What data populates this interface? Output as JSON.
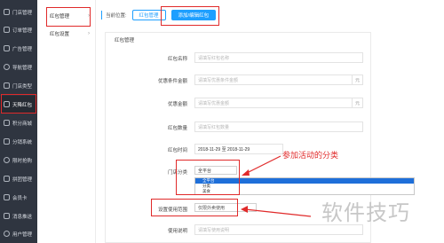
{
  "sidebar": {
    "items": [
      {
        "label": "门店管理"
      },
      {
        "label": "订单管理"
      },
      {
        "label": "广告管理"
      },
      {
        "label": "导航管理"
      },
      {
        "label": "门店类型"
      },
      {
        "label": "天降红包"
      },
      {
        "label": "积分商城"
      },
      {
        "label": "分销系统"
      },
      {
        "label": "限时抢购"
      },
      {
        "label": "拼团管理"
      },
      {
        "label": "会员卡"
      },
      {
        "label": "消息推送"
      },
      {
        "label": "用户管理"
      }
    ],
    "active_index": 5
  },
  "submenu": {
    "items": [
      {
        "label": "红包管理"
      },
      {
        "label": "红包设置"
      }
    ]
  },
  "topbar": {
    "crumb_label": "当前位置:",
    "tabs": [
      {
        "label": "红包管理"
      },
      {
        "label": "添加/编辑红包"
      }
    ]
  },
  "panel": {
    "title": "红包管理",
    "fields": [
      {
        "label": "红包名称",
        "placeholder": "请填写红包名称"
      },
      {
        "label": "优惠条件金额",
        "placeholder": "请填写优惠条件金额",
        "unit": "元"
      },
      {
        "label": "优惠金额",
        "placeholder": "请填写优惠金额",
        "unit": "元"
      },
      {
        "label": "红包数量",
        "placeholder": "请填写红包数量"
      },
      {
        "label": "红包时间",
        "value": "2018-11-29 至 2018-11-29"
      },
      {
        "label": "门店分类"
      },
      {
        "label": "设置使用范围",
        "placeholder": "仅限外卖使用"
      },
      {
        "label": "使用说明",
        "placeholder": "请填写使用说明"
      }
    ],
    "category_select": {
      "value": "全平台",
      "options": [
        "全平台",
        "全平台",
        "分类",
        "美食"
      ]
    }
  },
  "annotation": "参加活动的分类",
  "watermark": "软件技巧"
}
